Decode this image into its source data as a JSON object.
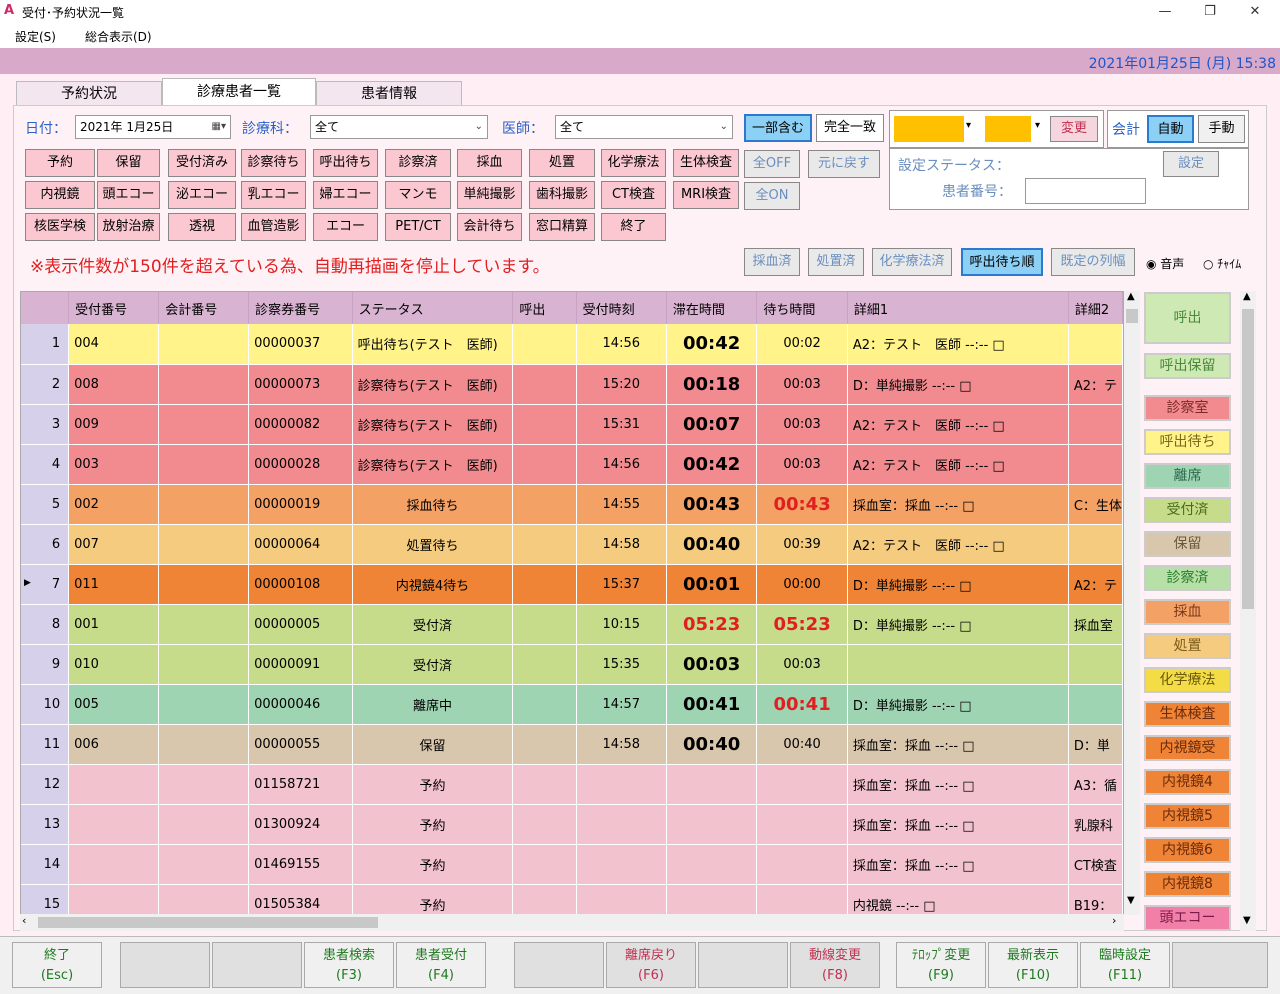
{
  "window": {
    "title": "受付･予約状況一覧",
    "logo": "A"
  },
  "menu": [
    "設定(S)",
    "総合表示(D)"
  ],
  "datetime": "2021年01月25日 (月) 15:38",
  "tabs": [
    "予約状況",
    "診療患者一覧",
    "患者情報"
  ],
  "filter": {
    "date_label": "日付：",
    "date_value": "2021年  1月25日",
    "dept_label": "診療科：",
    "dept_value": "全て",
    "doctor_label": "医師：",
    "doctor_value": "全て",
    "partial": "一部含む",
    "exact": "完全一致",
    "change": "変更",
    "kaikei_label": "会計",
    "auto": "自動",
    "manual": "手動"
  },
  "status_buttons": [
    [
      "予約",
      "保留",
      "受付済み",
      "診察待ち",
      "呼出待ち",
      "診察済",
      "採血",
      "処置",
      "化学療法",
      "生体検査"
    ],
    [
      "内視鏡",
      "頭エコー",
      "泌エコー",
      "乳エコー",
      "婦エコー",
      "マンモ",
      "単純撮影",
      "歯科撮影",
      "CT検査",
      "MRI検査"
    ],
    [
      "核医学検",
      "放射治療",
      "透視",
      "血管造影",
      "エコー",
      "PET/CT",
      "会計待ち",
      "窓口精算",
      "終了"
    ]
  ],
  "ctrl": {
    "all_off": "全OFF",
    "restore": "元に戻す",
    "all_on": "全ON",
    "set_status": "設定ステータス：",
    "patient_no": "患者番号：",
    "set": "設定"
  },
  "warning": "※表示件数が150件を超えている為、自動再描画を停止しています。",
  "view_buttons": [
    "採血済",
    "処置済",
    "化学療法済",
    "呼出待ち順",
    "既定の列幅"
  ],
  "sound": {
    "voice": "音声",
    "chime": "ﾁｬｲﾑ"
  },
  "columns": [
    "",
    "受付番号",
    "会計番号",
    "診察券番号",
    "ステータス",
    "呼出",
    "受付時刻",
    "滞在時間",
    "待ち時間",
    "詳細1",
    "詳細2"
  ],
  "rows": [
    {
      "n": "1",
      "uke": "004",
      "card": "00000037",
      "status": "呼出待ち(テスト　医師)",
      "time": "14:56",
      "stay": "00:42",
      "wait": "00:02",
      "d1": "A2：テスト　医師 --:-- □",
      "d2": "",
      "color": "#fff38a",
      "wred": false,
      "sred": false,
      "sc": false
    },
    {
      "n": "2",
      "uke": "008",
      "card": "00000073",
      "status": "診察待ち(テスト　医師)",
      "time": "15:20",
      "stay": "00:18",
      "wait": "00:03",
      "d1": "D：単純撮影 --:-- □",
      "d2": "A2：テ",
      "color": "#f28b8f",
      "wred": false,
      "sred": false,
      "sc": false
    },
    {
      "n": "3",
      "uke": "009",
      "card": "00000082",
      "status": "診察待ち(テスト　医師)",
      "time": "15:31",
      "stay": "00:07",
      "wait": "00:03",
      "d1": "A2：テスト　医師 --:-- □",
      "d2": "",
      "color": "#f28b8f",
      "wred": false,
      "sred": false,
      "sc": false
    },
    {
      "n": "4",
      "uke": "003",
      "card": "00000028",
      "status": "診察待ち(テスト　医師)",
      "time": "14:56",
      "stay": "00:42",
      "wait": "00:03",
      "d1": "A2：テスト　医師 --:-- □",
      "d2": "",
      "color": "#f28b8f",
      "wred": false,
      "sred": false,
      "sc": false
    },
    {
      "n": "5",
      "uke": "002",
      "card": "00000019",
      "status": "採血待ち",
      "time": "14:55",
      "stay": "00:43",
      "wait": "00:43",
      "d1": "採血室：採血 --:-- □",
      "d2": "C：生体",
      "color": "#f4a166",
      "wred": true,
      "sred": false,
      "sc": true
    },
    {
      "n": "6",
      "uke": "007",
      "card": "00000064",
      "status": "処置待ち",
      "time": "14:58",
      "stay": "00:40",
      "wait": "00:39",
      "d1": "A2：テスト　医師 --:-- □",
      "d2": "",
      "color": "#f5cc7f",
      "wred": false,
      "sred": false,
      "sc": true
    },
    {
      "n": "7",
      "uke": "011",
      "card": "00000108",
      "status": "内視鏡4待ち",
      "time": "15:37",
      "stay": "00:01",
      "wait": "00:00",
      "d1": "D：単純撮影 --:-- □",
      "d2": "A2：テ",
      "color": "#ef8436",
      "wred": false,
      "sred": false,
      "sc": true
    },
    {
      "n": "8",
      "uke": "001",
      "card": "00000005",
      "status": "受付済",
      "time": "10:15",
      "stay": "05:23",
      "wait": "05:23",
      "d1": "D：単純撮影 --:-- □",
      "d2": "採血室",
      "color": "#c6dc8a",
      "wred": true,
      "sred": true,
      "sc": true
    },
    {
      "n": "9",
      "uke": "010",
      "card": "00000091",
      "status": "受付済",
      "time": "15:35",
      "stay": "00:03",
      "wait": "00:03",
      "d1": "",
      "d2": "",
      "color": "#c6dc8a",
      "wred": false,
      "sred": false,
      "sc": true
    },
    {
      "n": "10",
      "uke": "005",
      "card": "00000046",
      "status": "離席中",
      "time": "14:57",
      "stay": "00:41",
      "wait": "00:41",
      "d1": "D：単純撮影 --:-- □",
      "d2": "",
      "color": "#9fd4b3",
      "wred": true,
      "sred": false,
      "sc": true
    },
    {
      "n": "11",
      "uke": "006",
      "card": "00000055",
      "status": "保留",
      "time": "14:58",
      "stay": "00:40",
      "wait": "00:40",
      "d1": "採血室：採血 --:-- □",
      "d2": "D：単",
      "color": "#d9c7ad",
      "wred": false,
      "sred": false,
      "sc": true
    },
    {
      "n": "12",
      "uke": "",
      "card": "01158721",
      "status": "予約",
      "time": "",
      "stay": "",
      "wait": "",
      "d1": "採血室：採血 --:-- □",
      "d2": "A3：循",
      "color": "#f3c2cf",
      "wred": false,
      "sred": false,
      "sc": true
    },
    {
      "n": "13",
      "uke": "",
      "card": "01300924",
      "status": "予約",
      "time": "",
      "stay": "",
      "wait": "",
      "d1": "採血室：採血 --:-- □",
      "d2": "乳腺科",
      "color": "#f3c2cf",
      "wred": false,
      "sred": false,
      "sc": true
    },
    {
      "n": "14",
      "uke": "",
      "card": "01469155",
      "status": "予約",
      "time": "",
      "stay": "",
      "wait": "",
      "d1": "採血室：採血 --:-- □",
      "d2": "CT検査",
      "color": "#f3c2cf",
      "wred": false,
      "sred": false,
      "sc": true
    },
    {
      "n": "15",
      "uke": "",
      "card": "01505384",
      "status": "予約",
      "time": "",
      "stay": "",
      "wait": "",
      "d1": "内視鏡 --:-- □",
      "d2": "B19：",
      "color": "#f3c2cf",
      "wred": false,
      "sred": false,
      "sc": true
    }
  ],
  "side_buttons": [
    {
      "label": "呼出",
      "bg": "#cfe9b4",
      "fg": "#4a8a3a"
    },
    {
      "label": "呼出保留",
      "bg": "#cfe9b4",
      "fg": "#4a8a3a"
    },
    {
      "label": "診察室",
      "bg": "#f28b8f",
      "fg": "#7a2a2a"
    },
    {
      "label": "呼出待ち",
      "bg": "#fff38a",
      "fg": "#7a6a1a"
    },
    {
      "label": "離席",
      "bg": "#9fd4b3",
      "fg": "#2a6a4a"
    },
    {
      "label": "受付済",
      "bg": "#c6dc8a",
      "fg": "#4a6a1a"
    },
    {
      "label": "保留",
      "bg": "#d9c7ad",
      "fg": "#6a5a3a"
    },
    {
      "label": "診察済",
      "bg": "#b6e0a8",
      "fg": "#2a7a2a"
    },
    {
      "label": "採血",
      "bg": "#f4a166",
      "fg": "#7a3a1a"
    },
    {
      "label": "処置",
      "bg": "#f5cc7f",
      "fg": "#7a5a1a"
    },
    {
      "label": "化学療法",
      "bg": "#f3dc45",
      "fg": "#6a5a0a"
    },
    {
      "label": "生体検査",
      "bg": "#ef8436",
      "fg": "#6a2a0a"
    },
    {
      "label": "内視鏡受",
      "bg": "#ef8436",
      "fg": "#6a2a0a"
    },
    {
      "label": "内視鏡4",
      "bg": "#ef8436",
      "fg": "#6a2a0a"
    },
    {
      "label": "内視鏡5",
      "bg": "#ef8436",
      "fg": "#6a2a0a"
    },
    {
      "label": "内視鏡6",
      "bg": "#ef8436",
      "fg": "#6a2a0a"
    },
    {
      "label": "内視鏡8",
      "bg": "#ef8436",
      "fg": "#6a2a0a"
    },
    {
      "label": "頭エコー",
      "bg": "#f27fa8",
      "fg": "#7a1a4a"
    }
  ],
  "fkeys": [
    {
      "l1": "終了",
      "l2": "(Esc)",
      "state": "on"
    },
    {
      "l1": "",
      "l2": "",
      "state": "off"
    },
    {
      "l1": "",
      "l2": "",
      "state": "off"
    },
    {
      "l1": "患者検索",
      "l2": "(F3)",
      "state": "on"
    },
    {
      "l1": "患者受付",
      "l2": "(F4)",
      "state": "on"
    },
    {
      "l1": "",
      "l2": "",
      "state": "off"
    },
    {
      "l1": "離席戻り",
      "l2": "(F6)",
      "state": "dis"
    },
    {
      "l1": "",
      "l2": "",
      "state": "off"
    },
    {
      "l1": "動線変更",
      "l2": "(F8)",
      "state": "dis"
    },
    {
      "l1": "ﾃﾛｯﾌﾟ変更",
      "l2": "(F9)",
      "state": "on"
    },
    {
      "l1": "最新表示",
      "l2": "(F10)",
      "state": "on"
    },
    {
      "l1": "臨時設定",
      "l2": "(F11)",
      "state": "on"
    },
    {
      "l1": "",
      "l2": "",
      "state": "off"
    }
  ]
}
